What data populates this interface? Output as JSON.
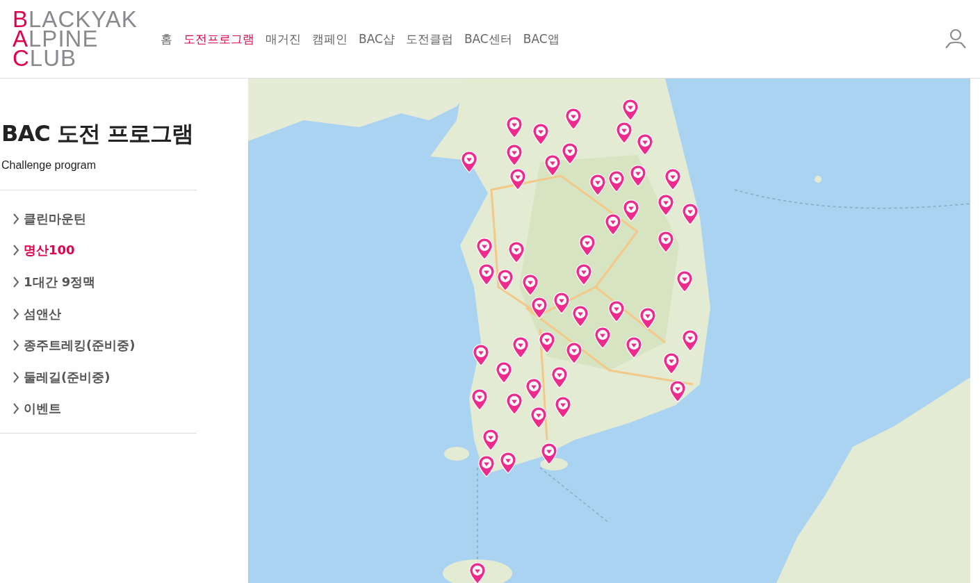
{
  "logo": [
    {
      "initial": "B",
      "rest": "LACKYAK"
    },
    {
      "initial": "A",
      "rest": "LPINE"
    },
    {
      "initial": "C",
      "rest": "LUB"
    }
  ],
  "nav": [
    {
      "label": "홈",
      "selected": false
    },
    {
      "label": "도전프로그램",
      "selected": true
    },
    {
      "label": "매거진",
      "selected": false
    },
    {
      "label": "캠페인",
      "selected": false
    },
    {
      "label": "BAC샵",
      "selected": false
    },
    {
      "label": "도전클럽",
      "selected": false
    },
    {
      "label": "BAC센터",
      "selected": false
    },
    {
      "label": "BAC앱",
      "selected": false
    }
  ],
  "sidebar": {
    "title": "BAC 도전 프로그램",
    "subtitle": "Challenge program",
    "items": [
      {
        "label": "클린마운틴",
        "selected": false
      },
      {
        "label": "명산100",
        "selected": true
      },
      {
        "label": "1대간 9정맥",
        "selected": false
      },
      {
        "label": "섬앤산",
        "selected": false
      },
      {
        "label": "종주트레킹(준비중)",
        "selected": false
      },
      {
        "label": "둘레길(준비중)",
        "selected": false
      },
      {
        "label": "이벤트",
        "selected": false
      }
    ]
  }
}
